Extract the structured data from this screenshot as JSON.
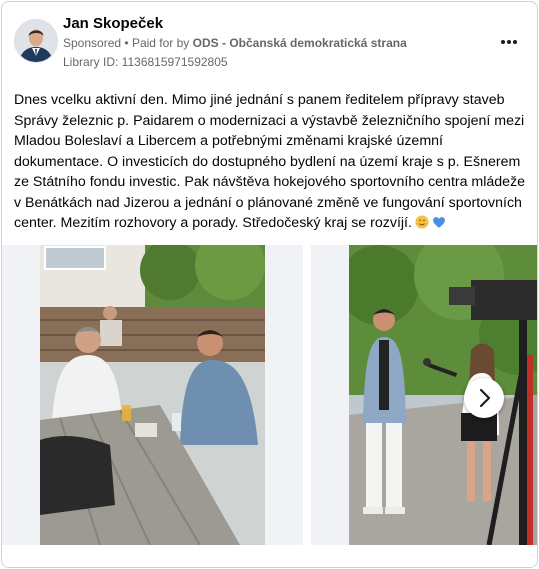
{
  "advertiser": {
    "name": "Jan Skopeček",
    "sponsored_label": "Sponsored",
    "separator": "•",
    "paid_for_prefix": "Paid for by",
    "paid_for_org": "ODS - Občanská demokratická strana",
    "library_id": "Library ID: 1136815971592805"
  },
  "menu": {
    "icon": "more-options-icon",
    "label": "•••"
  },
  "post": {
    "text": "Dnes vcelku aktivní den. Mimo jiné jednání s panem ředitelem přípravy staveb Správy železnic p. Paidarem o modernizaci a výstavbě železničního spojení mezi Mladou Boleslaví a Libercem a potřebnými změnami krajské územní dokumentace. O investicích do dostupného bydlení na území kraje s p. Ešnerem ze Státního fondu investic. Pak návštěva hokejového sportovního centra mládeže v Benátkách nad Jizerou a jednání o plánované změně ve fungování sportovních center. Mezitím rozhovory a porady. Středočeský kraj se rozvíjí.",
    "emojis": [
      "smiling-face-emoji",
      "blue-heart-emoji"
    ]
  },
  "carousel": {
    "slides": [
      {
        "icon": "photo-meeting-outdoor-cafe"
      },
      {
        "icon": "photo-tv-interview"
      }
    ],
    "next_icon": "chevron-right-icon"
  },
  "colors": {
    "text_primary": "#050505",
    "text_secondary": "#65676b",
    "border": "#cfd2d6",
    "slide_bg": "#f0f2f5"
  }
}
